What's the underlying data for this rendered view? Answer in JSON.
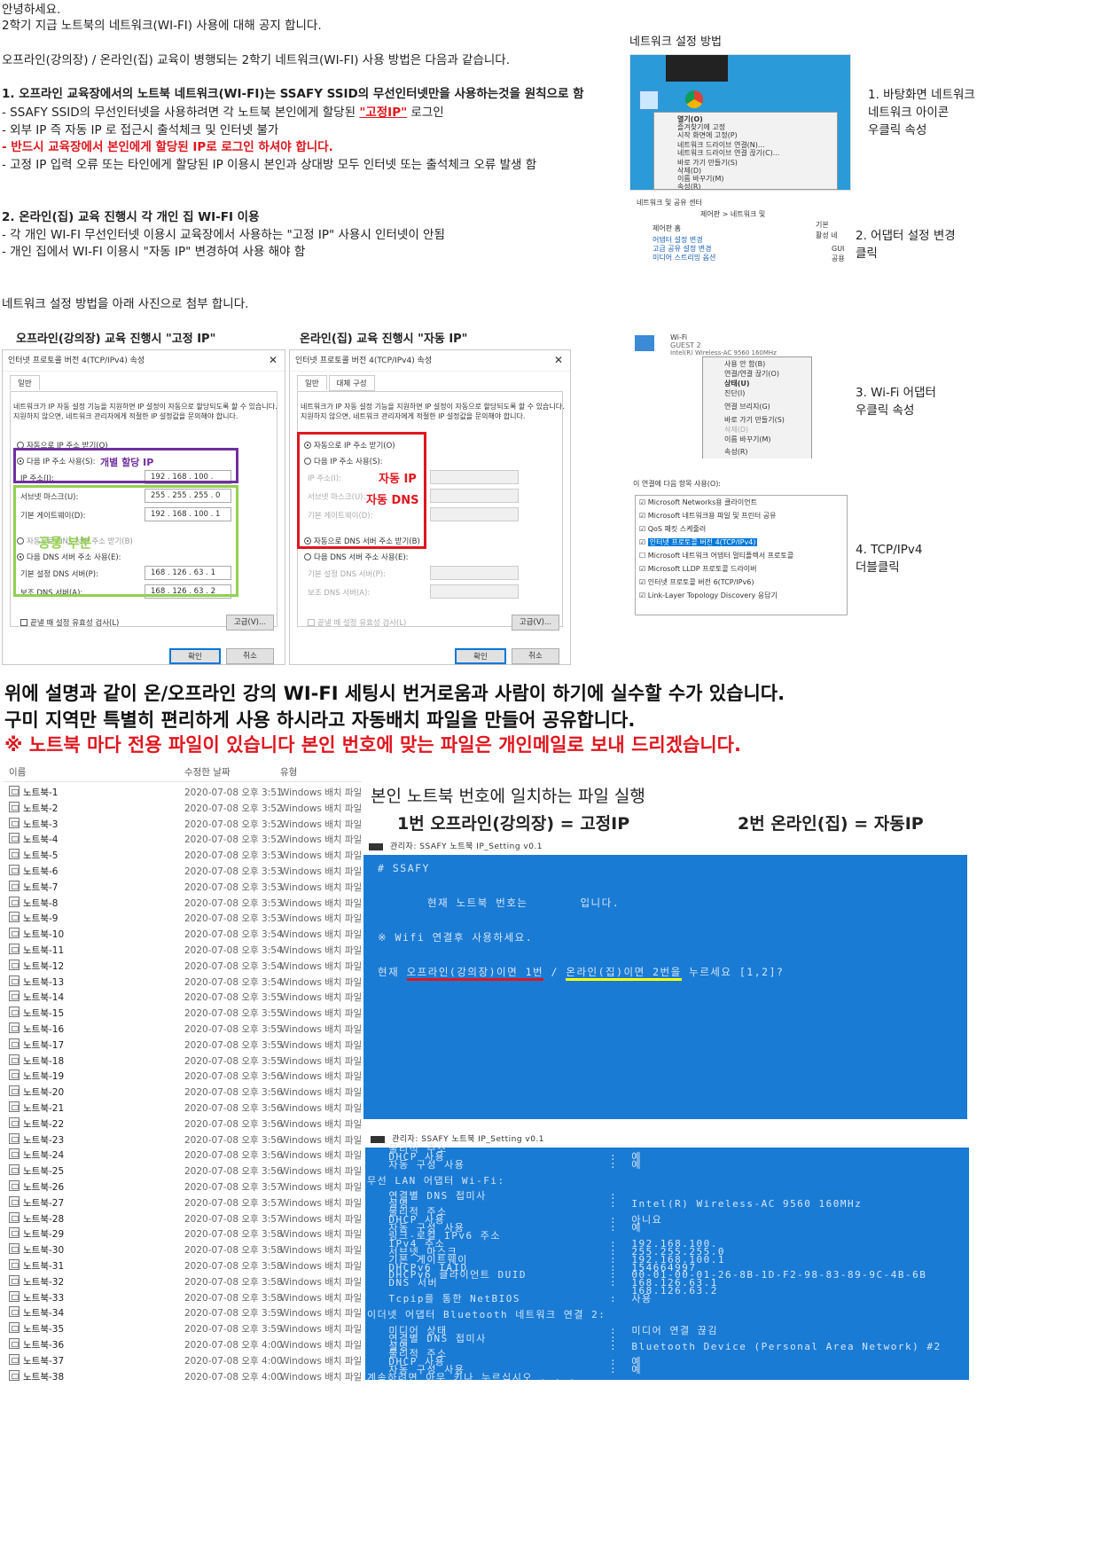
{
  "intro": {
    "greeting": "안녕하세요.",
    "notice": "2학기 지급 노트북의 네트워크(WI-FI) 사용에 대해 공지 합니다.",
    "method": "오프라인(강의장) / 온라인(집) 교육이 병행되는 2학기 네트워크(WI-FI) 사용 방법은 다음과 같습니다."
  },
  "section1": {
    "heading": "1. 오프라인 교육장에서의 노트북 네트워크(WI-FI)는 SSAFY SSID의 무선인터넷만을 사용하는것을 원칙으로 함",
    "line1_a": "- SSAFY SSID의 무선인터넷을 사용하려면 각 노트북 본인에게 할당된 ",
    "line1_b": "\"고정IP\"",
    "line1_c": " 로그인",
    "line2": "- 외부 IP 즉 자동 IP 로 접근시 출석체크 및 인터넷 불가",
    "line3": "-  반드시 교육장에서 본인에게 할당된 IP로 로그인 하셔야 합니다.",
    "line4": "- 고정 IP 입력 오류 또는 타인에게 할당된 IP 이용시 본인과 상대방 모두 인터넷 또는 출석체크 오류 발생 함"
  },
  "section2": {
    "heading": "2. 온라인(집) 교육 진행시 각 개인 집 WI-FI 이용",
    "line1": "- 각 개인 WI-FI 무선인터넷 이용시 교육장에서 사용하는 \"고정 IP\" 사용시 인터넷이 안됨",
    "line2": "- 개인 집에서 WI-FI 이용시 \"자동 IP\" 변경하여 사용 해야 함"
  },
  "attach_note": "네트워크 설정 방법을 아래 사진으로 첨부 합니다.",
  "offline_caption": "오프라인(강의장) 교육 진행시 \"고정 IP\"",
  "online_caption": "온라인(집) 교육 진행시 \"자동 IP\"",
  "dialog": {
    "title": "인터넷 프로토콜 버전 4(TCP/IPv4) 속성",
    "tab_general": "일반",
    "tab_alt": "대체 구성",
    "desc": "네트워크가 IP 자동 설정 기능을 지원하면 IP 설정이 자동으로 할당되도록 할 수 있습니다. 지원하지 않으면, 네트워크 관리자에게 적절한 IP 설정값을 문의해야 합니다.",
    "auto_ip": "자동으로 IP 주소 받기(O)",
    "manual_ip": "다음 IP 주소 사용(S):",
    "ip_label": "IP 주소(I):",
    "mask_label": "서브넷 마스크(U):",
    "gw_label": "기본 게이트웨이(D):",
    "auto_dns": "자동으로 DNS 서버 주소 받기(B)",
    "manual_dns": "다음 DNS 서버 주소 사용(E):",
    "dns1_label": "기본 설정 DNS 서버(P):",
    "dns2_label": "보조 DNS 서버(A):",
    "validate": "끝낼 때 설정 유효성 검사(L)",
    "advanced": "고급(V)...",
    "ok": "확인",
    "cancel": "취소"
  },
  "offline_values": {
    "ip": "192 . 168 . 100 .",
    "mask": "255 . 255 . 255 .   0",
    "gw": "192 . 168 . 100 .   1",
    "dns1": "168 . 126 .  63  .   1",
    "dns2": "168 . 126 .  63  .   2"
  },
  "annotations": {
    "individual": "개별 할당 IP",
    "common": "공통 부분",
    "auto_ip": "자동 IP",
    "auto_dns": "자동 DNS"
  },
  "right": {
    "header": "네트워크 설정 방법",
    "step1": "1. 바탕화면 네트워크\n네트워크 아이콘\n우클릭 속성",
    "step2": "2. 어댑터 설정 변경\n클릭",
    "step3": "3. Wi-Fi 어댑터\n우클릭 속성",
    "step4": "4. TCP/IPv4\n더블클릭",
    "ctx1": [
      "열기(O)",
      "즐겨찾기에 고정",
      "시작 화면에 고정(P)",
      "네트워크 드라이브 연결(N)...",
      "네트워크 드라이브 연결 끊기(C)...",
      "바로 가기 만들기(S)",
      "삭제(D)",
      "이름 바꾸기(M)",
      "속성(R)"
    ],
    "ctl": [
      "제어판 홈",
      "어댑터 설정 변경",
      "고급 공유 설정 변경",
      "미디어 스트리밍 옵션"
    ],
    "ctl_bar": "네트워크 및 공유 센터",
    "ctl_path": "제어판  >  네트워크 및",
    "ctl_side": [
      "기본 ",
      "활성 네",
      "GUI",
      "공용"
    ],
    "wifi_name": "Wi-Fi",
    "wifi_guest": "GUEST 2",
    "wifi_dev": "Intel(R) Wireless-AC 9560 160MHz",
    "ctx3": [
      "사용 안 함(B)",
      "연결/연결 끊기(O)",
      "상태(U)",
      "진단(I)",
      "연결 브리지(G)",
      "바로 가기 만들기(S)",
      "삭제(D)",
      "이름 바꾸기(M)",
      "속성(R)"
    ],
    "items_header": "이 연결에 다음 항목 사용(O):",
    "items": [
      "Microsoft Networks용 클라이언트",
      "Microsoft 네트워크용 파일 및 프린터 공유",
      "QoS 패킷 스케줄러",
      "인터넷 프로토콜 버전 4(TCP/IPv4)",
      "Microsoft 네트워크 어댑터 멀티플렉서 프로토콜",
      "Microsoft LLDP 프로토콜 드라이버",
      "인터넷 프로토콜 버전 6(TCP/IPv6)",
      "Link-Layer Topology Discovery 응답기"
    ]
  },
  "big": {
    "line1": "위에 설명과 같이 온/오프라인 강의 WI-FI 세팅시 번거로움과 사람이 하기에 실수할 수가 있습니다.",
    "line2": "구미 지역만 특별히 편리하게 사용 하시라고 자동배치 파일을 만들어 공유합니다.",
    "line3": "※ 노트북 마다 전용 파일이 있습니다 본인 번호에 맞는 파일은 개인메일로 보내 드리겠습니다."
  },
  "filelist": {
    "col_name": "이름",
    "col_date": "수정한 날짜",
    "col_type": "유형",
    "rows": [
      [
        "노트북-1",
        "2020-07-08 오후 3:51",
        "Windows 배치 파일"
      ],
      [
        "노트북-2",
        "2020-07-08 오후 3:52",
        "Windows 배치 파일"
      ],
      [
        "노트북-3",
        "2020-07-08 오후 3:52",
        "Windows 배치 파일"
      ],
      [
        "노트북-4",
        "2020-07-08 오후 3:52",
        "Windows 배치 파일"
      ],
      [
        "노트북-5",
        "2020-07-08 오후 3:53",
        "Windows 배치 파일"
      ],
      [
        "노트북-6",
        "2020-07-08 오후 3:53",
        "Windows 배치 파일"
      ],
      [
        "노트북-7",
        "2020-07-08 오후 3:53",
        "Windows 배치 파일"
      ],
      [
        "노트북-8",
        "2020-07-08 오후 3:53",
        "Windows 배치 파일"
      ],
      [
        "노트북-9",
        "2020-07-08 오후 3:53",
        "Windows 배치 파일"
      ],
      [
        "노트북-10",
        "2020-07-08 오후 3:54",
        "Windows 배치 파일"
      ],
      [
        "노트북-11",
        "2020-07-08 오후 3:54",
        "Windows 배치 파일"
      ],
      [
        "노트북-12",
        "2020-07-08 오후 3:54",
        "Windows 배치 파일"
      ],
      [
        "노트북-13",
        "2020-07-08 오후 3:54",
        "Windows 배치 파일"
      ],
      [
        "노트북-14",
        "2020-07-08 오후 3:55",
        "Windows 배치 파일"
      ],
      [
        "노트북-15",
        "2020-07-08 오후 3:55",
        "Windows 배치 파일"
      ],
      [
        "노트북-16",
        "2020-07-08 오후 3:55",
        "Windows 배치 파일"
      ],
      [
        "노트북-17",
        "2020-07-08 오후 3:55",
        "Windows 배치 파일"
      ],
      [
        "노트북-18",
        "2020-07-08 오후 3:55",
        "Windows 배치 파일"
      ],
      [
        "노트북-19",
        "2020-07-08 오후 3:56",
        "Windows 배치 파일"
      ],
      [
        "노트북-20",
        "2020-07-08 오후 3:56",
        "Windows 배치 파일"
      ],
      [
        "노트북-21",
        "2020-07-08 오후 3:56",
        "Windows 배치 파일"
      ],
      [
        "노트북-22",
        "2020-07-08 오후 3:56",
        "Windows 배치 파일"
      ],
      [
        "노트북-23",
        "2020-07-08 오후 3:56",
        "Windows 배치 파일"
      ],
      [
        "노트북-24",
        "2020-07-08 오후 3:56",
        "Windows 배치 파일"
      ],
      [
        "노트북-25",
        "2020-07-08 오후 3:56",
        "Windows 배치 파일"
      ],
      [
        "노트북-26",
        "2020-07-08 오후 3:57",
        "Windows 배치 파일"
      ],
      [
        "노트북-27",
        "2020-07-08 오후 3:57",
        "Windows 배치 파일"
      ],
      [
        "노트북-28",
        "2020-07-08 오후 3:57",
        "Windows 배치 파일"
      ],
      [
        "노트북-29",
        "2020-07-08 오후 3:58",
        "Windows 배치 파일"
      ],
      [
        "노트북-30",
        "2020-07-08 오후 3:58",
        "Windows 배치 파일"
      ],
      [
        "노트북-31",
        "2020-07-08 오후 3:58",
        "Windows 배치 파일"
      ],
      [
        "노트북-32",
        "2020-07-08 오후 3:58",
        "Windows 배치 파일"
      ],
      [
        "노트북-33",
        "2020-07-08 오후 3:58",
        "Windows 배치 파일"
      ],
      [
        "노트북-34",
        "2020-07-08 오후 3:59",
        "Windows 배치 파일"
      ],
      [
        "노트북-35",
        "2020-07-08 오후 3:59",
        "Windows 배치 파일"
      ],
      [
        "노트북-36",
        "2020-07-08 오후 4:00",
        "Windows 배치 파일"
      ],
      [
        "노트북-37",
        "2020-07-08 오후 4:00",
        "Windows 배치 파일"
      ],
      [
        "노트북-38",
        "2020-07-08 오후 4:00",
        "Windows 배치 파일"
      ]
    ]
  },
  "run": {
    "title": "본인 노트북 번호에 일치하는 파일 실행",
    "opt1": "1번  오프라인(강의장) = 고정IP",
    "opt2": "2번  온라인(집) = 자동IP"
  },
  "console1": {
    "bar": "관리자:  SSAFY 노트북 IP_Setting v0.1",
    "l1": "# SSAFY",
    "l2": "현재 노트북 번호는       입니다.",
    "l3": "※ Wifi 연결후 사용하세요.",
    "l4a": "현재 ",
    "l4b": "오프라인(강의장)이면 1번",
    "l4c": " / ",
    "l4d": "온라인(집)이면 2번을",
    "l4e": " 누르세요 [1,2]?"
  },
  "console2": {
    "bar": "관리자:  SSAFY 노트북 IP_Setting v0.1",
    "lines": [
      [
        "   물리적 주소",
        ""
      ],
      [
        "   DHCP 사용",
        ":  예"
      ],
      [
        "   자동 구성 사용",
        ":  예"
      ],
      [
        "",
        ""
      ],
      [
        "무선 LAN 어댑터 Wi-Fi:",
        ""
      ],
      [
        "",
        ""
      ],
      [
        "   연결별 DNS 접미사",
        ":"
      ],
      [
        "   설명",
        ":  Intel(R) Wireless-AC 9560 160MHz"
      ],
      [
        "   물리적 주소",
        ""
      ],
      [
        "   DHCP 사용",
        ":  아니요"
      ],
      [
        "   자동 구성 사용",
        ":  예"
      ],
      [
        "   링크-로컬 IPv6 주소",
        ""
      ],
      [
        "   IPv4 주소",
        ":  192.168.100."
      ],
      [
        "   서브넷 마스크",
        ":  255.255.255.0"
      ],
      [
        "   기본 게이트웨이",
        ":  192.168.100.1"
      ],
      [
        "   DHCPv6 IAID",
        ":  154664997"
      ],
      [
        "   DHCPv6 클라이언트 DUID",
        ":  00-01-00-01-26-8B-1D-F2-98-83-89-9C-4B-6B"
      ],
      [
        "   DNS 서버",
        ":  168.126.63.1"
      ],
      [
        "",
        "   168.126.63.2"
      ],
      [
        "   Tcpip를 통한 NetBIOS",
        ":  사용"
      ],
      [
        "",
        ""
      ],
      [
        "이더넷 어댑터 Bluetooth 네트워크 연결 2:",
        ""
      ],
      [
        "",
        ""
      ],
      [
        "   미디어 상태",
        ":  미디어 연결 끊김"
      ],
      [
        "   연결별 DNS 접미사",
        ":"
      ],
      [
        "   설명",
        ":  Bluetooth Device (Personal Area Network) #2"
      ],
      [
        "   물리적 주소",
        ""
      ],
      [
        "   DHCP 사용",
        ":  예"
      ],
      [
        "   자동 구성 사용",
        ":  예"
      ],
      [
        "계속하려면 아무 키나 누르십시오 . . .",
        ""
      ]
    ]
  },
  "colors": {
    "red": "#e0161e",
    "purple": "#7030a0",
    "green": "#92d050",
    "console_bg": "#1a7bd4",
    "yellow": "#ffff00"
  }
}
